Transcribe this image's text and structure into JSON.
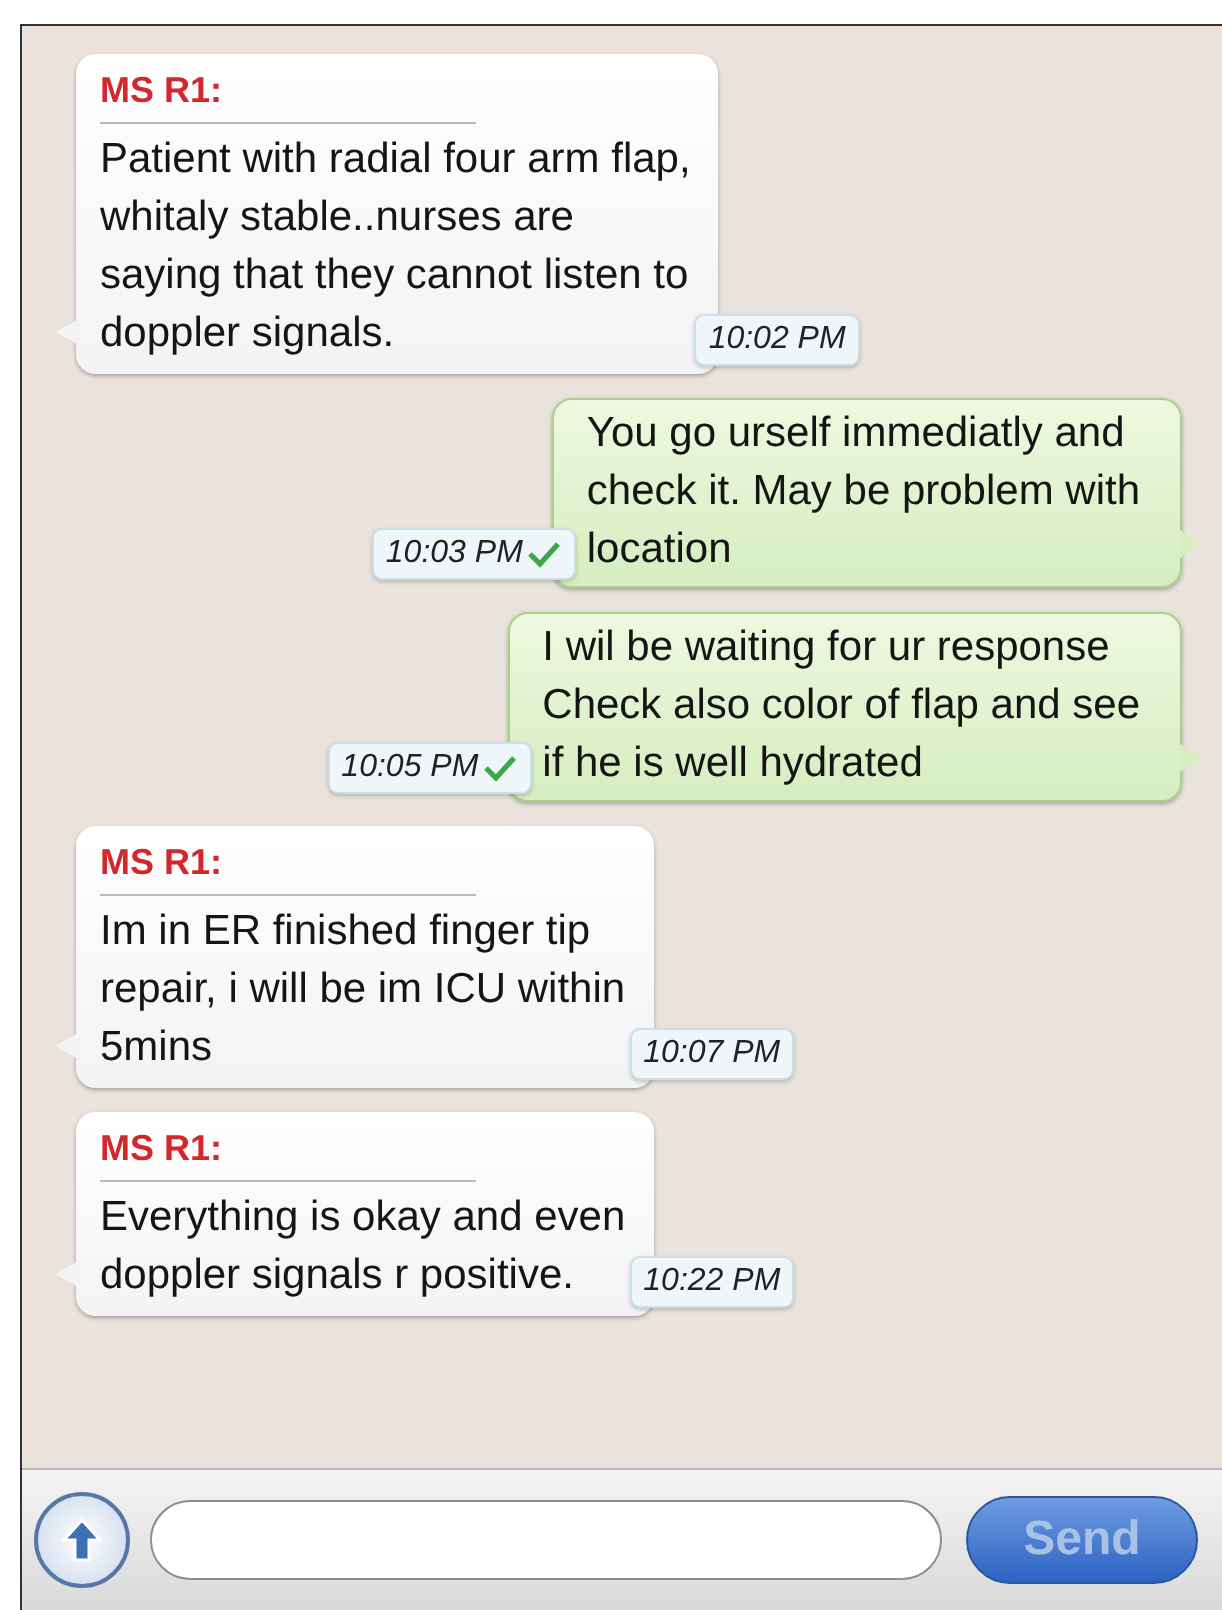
{
  "messages": [
    {
      "kind": "incoming",
      "sender": "MS R1:",
      "text": "Patient with radial four arm flap,\nwhitaly stable..nurses are\nsaying that they cannot listen to\ndoppler signals.",
      "time": "10:02 PM"
    },
    {
      "kind": "outgoing",
      "text": "You go urself immediatly and\ncheck it. May be problem with\nlocation",
      "time": "10:03 PM",
      "delivered": true
    },
    {
      "kind": "outgoing",
      "text": "I wil be waiting for ur response\nCheck also color of flap and see\nif he is well hydrated",
      "time": "10:05 PM",
      "delivered": true
    },
    {
      "kind": "incoming",
      "sender": "MS R1:",
      "text": "Im in ER finished finger tip\nrepair, i will be im ICU within\n5mins",
      "time": "10:07 PM"
    },
    {
      "kind": "incoming",
      "sender": "MS R1:",
      "text": "Everything is okay and even\ndoppler signals r positive.",
      "time": "10:22 PM"
    }
  ],
  "send_button": {
    "label": "Send",
    "disabled": true
  }
}
